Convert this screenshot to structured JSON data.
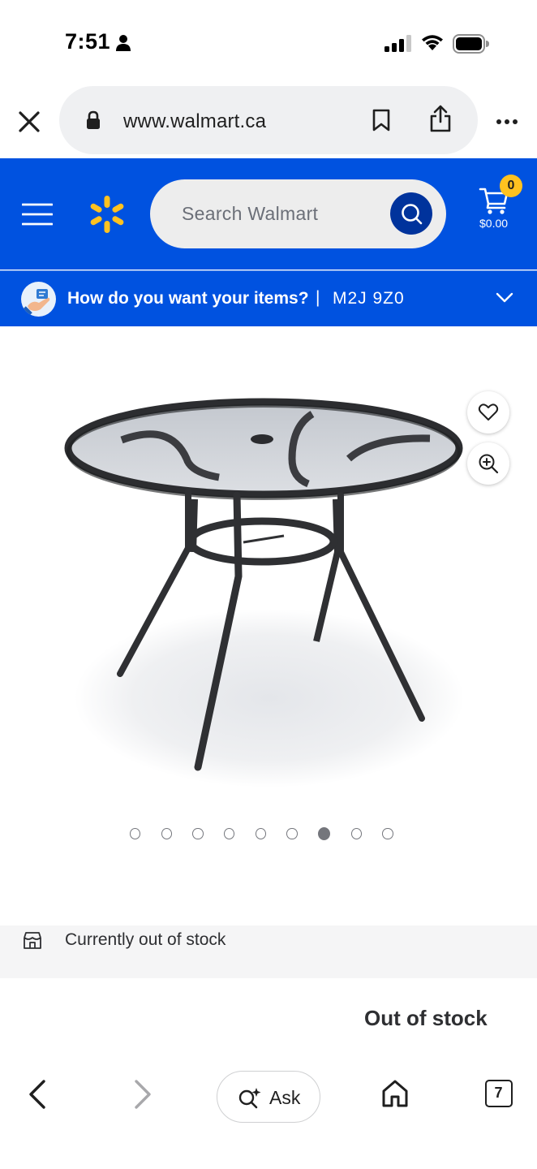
{
  "status_bar": {
    "time": "7:51"
  },
  "browser": {
    "url": "www.walmart.ca"
  },
  "header": {
    "search_placeholder": "Search Walmart",
    "cart_count": "0",
    "cart_total": "$0.00",
    "brand_color": "#0052e0",
    "spark_color": "#ffc220"
  },
  "delivery": {
    "question": "How do you want your items?",
    "separator": "|",
    "postal_code": "M2J 9Z0"
  },
  "product": {
    "image_icon": "patio-table-image",
    "carousel_total": 9,
    "carousel_active_index": 6
  },
  "stock": {
    "status_text": "Currently out of stock",
    "out_of_stock_label": "Out of stock"
  },
  "toolbar": {
    "ask_label": "Ask",
    "tab_count": "7"
  }
}
